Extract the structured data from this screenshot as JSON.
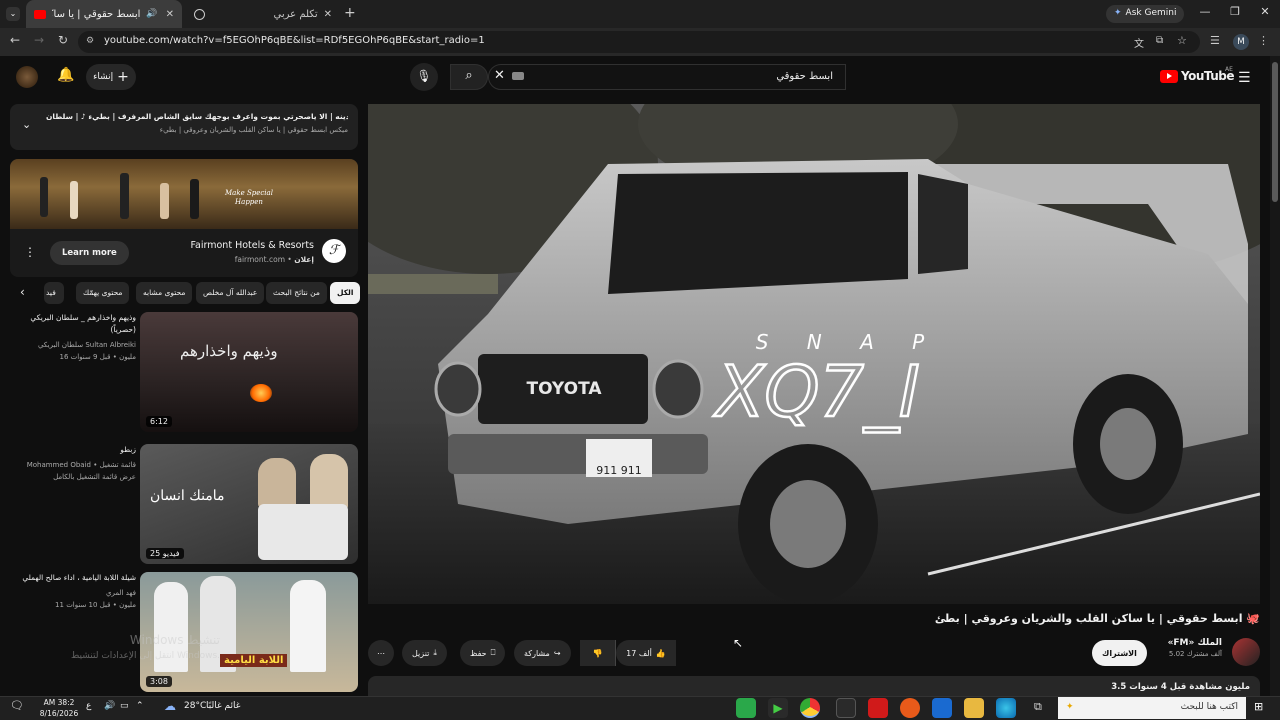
{
  "browser": {
    "tabs": [
      {
        "label": "ابسط حقوقي | يا ساكن القـ"
      },
      {
        "label": "تكلم عربي"
      }
    ],
    "url": "youtube.com/watch?v=f5EGOhP6qBE&list=RDf5EGOhP6qBE&start_radio=1",
    "gemini_label": "Ask Gemini",
    "profile_initial": "M"
  },
  "header": {
    "logo_text": "YouTube",
    "region": "AE",
    "search_value": "ابسط حقوقي",
    "create_label": "إنشاء"
  },
  "upnext": {
    "line1": "التالي: خط المدينه | الا ياصحرتي بموت واعرف بوجهك سايق الشاص المرفرف | بطيء ♪ | سلطان ...",
    "line2": "ميكس ابسط حقوقي | يا ساكن القلب والشريان وعروقي | بطيء"
  },
  "ad": {
    "advertiser": "Fairmont Hotels & Resorts",
    "sponsored_label": "إعلان",
    "domain": "fairmont.com",
    "cta": "Learn more",
    "image_caption": "Make Special Happen"
  },
  "chips": [
    {
      "label": "الكل"
    },
    {
      "label": "من نتائج البحث"
    },
    {
      "label": "عبدالله آل مخلص"
    },
    {
      "label": "محتوى مشابه"
    },
    {
      "label": "محتوى يهمّك"
    },
    {
      "label": "فيد"
    }
  ],
  "videos": [
    {
      "title": "وذيهم واخذارهم _ سلطان البريكي (حصرياً)",
      "channel": "سلطان البريكي Sultan Albreiki",
      "views": "16 مليون",
      "age": "قبل 9 سنوات",
      "duration": "6:12",
      "thumb_text": "وذيهم واخذارهم"
    },
    {
      "title": "زبطو",
      "channel": "Mohammed Obaid • قائمة تشغيل",
      "meta": "عرض قائمة التشغيل بالكامل",
      "duration": "25 فيديو",
      "thumb_text": "مامنك انسان"
    },
    {
      "title": "شيلة اللابة اليامية ، اداء صالح الهملي",
      "channel": "فهد المري",
      "views": "11 مليون",
      "age": "قبل 10 سنوات",
      "duration": "3:08",
      "thumb_text": "اللابة اليامية"
    }
  ],
  "player": {
    "overlay_small": "S N A P",
    "overlay_big": "XQ7_I",
    "plate": "911 911"
  },
  "video": {
    "title": "ابسط حقوقي | يا ساكن القلب والشريان وعروقي | بطئ 🐙",
    "channel": "«FM» الملك",
    "subscribers": "5.02 آلف مشترك",
    "subscribe_label": "الاشتراك",
    "likes": "17 ألف",
    "share_label": "مشاركة",
    "save_label": "حفظ",
    "download_label": "تنزيل",
    "description_stats": "3.5 مليون مشاهدة قبل 4 سنوات"
  },
  "watermark": {
    "line1": "Windows تنشيط",
    "line2": "انتقل إلى الإعدادات لتنشيط Windows."
  },
  "taskbar": {
    "search_placeholder": "اكتب هنا للبحث",
    "weather_temp": "28°C",
    "weather_text": "غائم غالبًا",
    "time": "AM 38:2",
    "date": "8/16/2026"
  },
  "colors": {
    "brand_red": "#ff0000",
    "bg": "#0f0f0f",
    "surface": "#272727"
  }
}
